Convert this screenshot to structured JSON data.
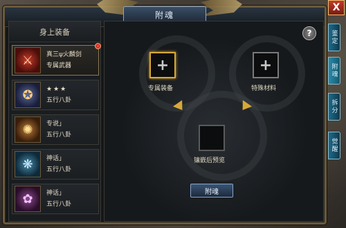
{
  "window": {
    "title": "附魂",
    "close_label": "X",
    "help_label": "?"
  },
  "equipment_panel": {
    "header": "身上装备",
    "items": [
      {
        "name": "真三ψ火麟剑",
        "sub": "专属武器",
        "icon": "flame-sword-icon",
        "has_alert": true
      },
      {
        "name": "★★★",
        "sub": "五行八卦",
        "icon": "bagua-amulet-icon",
        "has_alert": false
      },
      {
        "name": "专说」",
        "sub": "五行八卦",
        "icon": "bagua-gold-icon",
        "has_alert": false
      },
      {
        "name": "神话」",
        "sub": "五行八卦",
        "icon": "bagua-teal-icon",
        "has_alert": false
      },
      {
        "name": "神话」",
        "sub": "五行八卦",
        "icon": "bagua-purple-icon",
        "has_alert": false
      }
    ]
  },
  "slots": {
    "exclusive_label": "专属装备",
    "special_label": "特殊材料",
    "preview_label": "镶嵌后预览",
    "add_symbol": "+"
  },
  "confirm_button": "附魂",
  "side_tabs": [
    {
      "label": "鉴定",
      "active": false
    },
    {
      "label": "附魂",
      "active": true
    },
    {
      "label": "拆分",
      "active": false
    },
    {
      "label": "觉醒",
      "active": false
    }
  ],
  "colors": {
    "accent_gold": "#d8a838",
    "title_blue": "#3a4e66",
    "alert_red": "#ff5040"
  }
}
